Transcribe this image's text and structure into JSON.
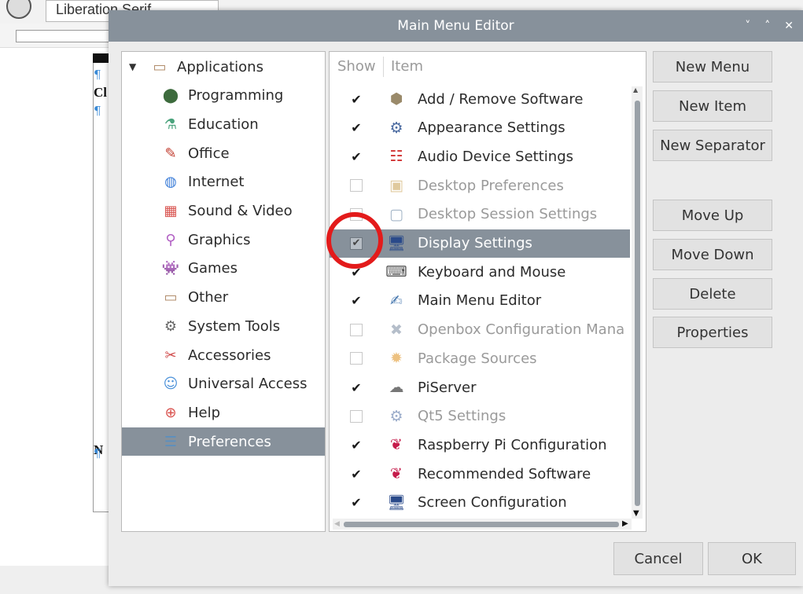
{
  "background": {
    "font_name": "Liberation Serif",
    "text_1": "Cl",
    "text_2": "N"
  },
  "dialog": {
    "title": "Main Menu Editor",
    "controls": [
      "˅",
      "˄",
      "✕"
    ]
  },
  "tree": {
    "root_label": "Applications",
    "items": [
      {
        "label": "Programming",
        "icon": "programming-icon",
        "glyph": "⬤",
        "color": "#3d6b3d"
      },
      {
        "label": "Education",
        "icon": "education-icon",
        "glyph": "⚗",
        "color": "#4aa37c"
      },
      {
        "label": "Office",
        "icon": "office-icon",
        "glyph": "✎",
        "color": "#c0392b"
      },
      {
        "label": "Internet",
        "icon": "internet-icon",
        "glyph": "◍",
        "color": "#3b7dd8"
      },
      {
        "label": "Sound & Video",
        "icon": "sound-video-icon",
        "glyph": "▦",
        "color": "#d9534f"
      },
      {
        "label": "Graphics",
        "icon": "graphics-icon",
        "glyph": "⚲",
        "color": "#b15fc3"
      },
      {
        "label": "Games",
        "icon": "games-icon",
        "glyph": "👾",
        "color": "#3aa84a"
      },
      {
        "label": "Other",
        "icon": "other-icon",
        "glyph": "▭",
        "color": "#b08b6a"
      },
      {
        "label": "System Tools",
        "icon": "system-tools-icon",
        "glyph": "⚙",
        "color": "#666666"
      },
      {
        "label": "Accessories",
        "icon": "accessories-icon",
        "glyph": "✂",
        "color": "#d04a4a"
      },
      {
        "label": "Universal Access",
        "icon": "universal-access-icon",
        "glyph": "☺",
        "color": "#4a90d9"
      },
      {
        "label": "Help",
        "icon": "help-icon",
        "glyph": "⊕",
        "color": "#d9534f"
      },
      {
        "label": "Preferences",
        "icon": "preferences-icon",
        "glyph": "☰",
        "color": "#5a8fc0"
      }
    ],
    "selected": "Preferences"
  },
  "list": {
    "col_show": "Show",
    "col_item": "Item",
    "items": [
      {
        "label": "Add / Remove Software",
        "checked": true,
        "icon": "package-icon",
        "glyph": "⬢",
        "color": "#9a8a6a"
      },
      {
        "label": "Appearance Settings",
        "checked": true,
        "icon": "appearance-icon",
        "glyph": "⚙",
        "color": "#4a6aa0"
      },
      {
        "label": "Audio Device Settings",
        "checked": true,
        "icon": "audio-icon",
        "glyph": "☷",
        "color": "#d03030"
      },
      {
        "label": "Desktop Preferences",
        "checked": false,
        "icon": "desktop-prefs-icon",
        "glyph": "▣",
        "color": "#c8a050"
      },
      {
        "label": "Desktop Session Settings",
        "checked": false,
        "icon": "session-icon",
        "glyph": "▢",
        "color": "#5a7a9a"
      },
      {
        "label": "Display Settings",
        "checked": true,
        "icon": "display-icon",
        "glyph": "🖥",
        "color": "#2a4a8a"
      },
      {
        "label": "Keyboard and Mouse",
        "checked": true,
        "icon": "keyboard-icon",
        "glyph": "⌨",
        "color": "#555555"
      },
      {
        "label": "Main Menu Editor",
        "checked": true,
        "icon": "menu-editor-icon",
        "glyph": "✍",
        "color": "#4a7ab0"
      },
      {
        "label": "Openbox Configuration Mana",
        "checked": false,
        "icon": "openbox-icon",
        "glyph": "✖",
        "color": "#7a8aa0"
      },
      {
        "label": "Package Sources",
        "checked": false,
        "icon": "package-sources-icon",
        "glyph": "✹",
        "color": "#e0901a"
      },
      {
        "label": "PiServer",
        "checked": true,
        "icon": "piserver-icon",
        "glyph": "☁",
        "color": "#777777"
      },
      {
        "label": "Qt5 Settings",
        "checked": false,
        "icon": "qt5-icon",
        "glyph": "⚙",
        "color": "#4a6aa0"
      },
      {
        "label": "Raspberry Pi Configuration",
        "checked": true,
        "icon": "raspberry-icon",
        "glyph": "❦",
        "color": "#c51a4a"
      },
      {
        "label": "Recommended Software",
        "checked": true,
        "icon": "raspberry-icon",
        "glyph": "❦",
        "color": "#c51a4a"
      },
      {
        "label": "Screen Configuration",
        "checked": true,
        "icon": "screen-icon",
        "glyph": "🖥",
        "color": "#2a4a8a"
      }
    ],
    "selected": "Display Settings"
  },
  "buttons": {
    "new_menu": "New Menu",
    "new_item": "New Item",
    "new_separator": "New Separator",
    "move_up": "Move Up",
    "move_down": "Move Down",
    "delete": "Delete",
    "properties": "Properties",
    "cancel": "Cancel",
    "ok": "OK"
  },
  "colors": {
    "selection": "#87919b",
    "titlebar": "#87919b",
    "annotation": "#e31b1b"
  }
}
